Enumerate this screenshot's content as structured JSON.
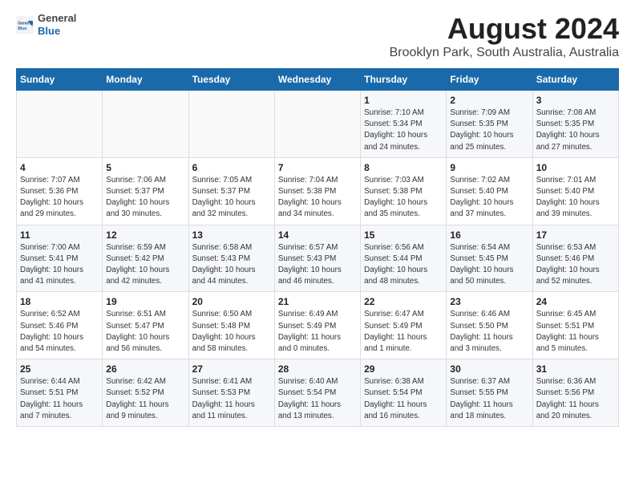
{
  "header": {
    "logo_general": "General",
    "logo_blue": "Blue",
    "title": "August 2024",
    "subtitle": "Brooklyn Park, South Australia, Australia"
  },
  "calendar": {
    "days_of_week": [
      "Sunday",
      "Monday",
      "Tuesday",
      "Wednesday",
      "Thursday",
      "Friday",
      "Saturday"
    ],
    "weeks": [
      [
        {
          "day": "",
          "info": ""
        },
        {
          "day": "",
          "info": ""
        },
        {
          "day": "",
          "info": ""
        },
        {
          "day": "",
          "info": ""
        },
        {
          "day": "1",
          "info": "Sunrise: 7:10 AM\nSunset: 5:34 PM\nDaylight: 10 hours\nand 24 minutes."
        },
        {
          "day": "2",
          "info": "Sunrise: 7:09 AM\nSunset: 5:35 PM\nDaylight: 10 hours\nand 25 minutes."
        },
        {
          "day": "3",
          "info": "Sunrise: 7:08 AM\nSunset: 5:35 PM\nDaylight: 10 hours\nand 27 minutes."
        }
      ],
      [
        {
          "day": "4",
          "info": "Sunrise: 7:07 AM\nSunset: 5:36 PM\nDaylight: 10 hours\nand 29 minutes."
        },
        {
          "day": "5",
          "info": "Sunrise: 7:06 AM\nSunset: 5:37 PM\nDaylight: 10 hours\nand 30 minutes."
        },
        {
          "day": "6",
          "info": "Sunrise: 7:05 AM\nSunset: 5:37 PM\nDaylight: 10 hours\nand 32 minutes."
        },
        {
          "day": "7",
          "info": "Sunrise: 7:04 AM\nSunset: 5:38 PM\nDaylight: 10 hours\nand 34 minutes."
        },
        {
          "day": "8",
          "info": "Sunrise: 7:03 AM\nSunset: 5:38 PM\nDaylight: 10 hours\nand 35 minutes."
        },
        {
          "day": "9",
          "info": "Sunrise: 7:02 AM\nSunset: 5:40 PM\nDaylight: 10 hours\nand 37 minutes."
        },
        {
          "day": "10",
          "info": "Sunrise: 7:01 AM\nSunset: 5:40 PM\nDaylight: 10 hours\nand 39 minutes."
        }
      ],
      [
        {
          "day": "11",
          "info": "Sunrise: 7:00 AM\nSunset: 5:41 PM\nDaylight: 10 hours\nand 41 minutes."
        },
        {
          "day": "12",
          "info": "Sunrise: 6:59 AM\nSunset: 5:42 PM\nDaylight: 10 hours\nand 42 minutes."
        },
        {
          "day": "13",
          "info": "Sunrise: 6:58 AM\nSunset: 5:43 PM\nDaylight: 10 hours\nand 44 minutes."
        },
        {
          "day": "14",
          "info": "Sunrise: 6:57 AM\nSunset: 5:43 PM\nDaylight: 10 hours\nand 46 minutes."
        },
        {
          "day": "15",
          "info": "Sunrise: 6:56 AM\nSunset: 5:44 PM\nDaylight: 10 hours\nand 48 minutes."
        },
        {
          "day": "16",
          "info": "Sunrise: 6:54 AM\nSunset: 5:45 PM\nDaylight: 10 hours\nand 50 minutes."
        },
        {
          "day": "17",
          "info": "Sunrise: 6:53 AM\nSunset: 5:46 PM\nDaylight: 10 hours\nand 52 minutes."
        }
      ],
      [
        {
          "day": "18",
          "info": "Sunrise: 6:52 AM\nSunset: 5:46 PM\nDaylight: 10 hours\nand 54 minutes."
        },
        {
          "day": "19",
          "info": "Sunrise: 6:51 AM\nSunset: 5:47 PM\nDaylight: 10 hours\nand 56 minutes."
        },
        {
          "day": "20",
          "info": "Sunrise: 6:50 AM\nSunset: 5:48 PM\nDaylight: 10 hours\nand 58 minutes."
        },
        {
          "day": "21",
          "info": "Sunrise: 6:49 AM\nSunset: 5:49 PM\nDaylight: 11 hours\nand 0 minutes."
        },
        {
          "day": "22",
          "info": "Sunrise: 6:47 AM\nSunset: 5:49 PM\nDaylight: 11 hours\nand 1 minute."
        },
        {
          "day": "23",
          "info": "Sunrise: 6:46 AM\nSunset: 5:50 PM\nDaylight: 11 hours\nand 3 minutes."
        },
        {
          "day": "24",
          "info": "Sunrise: 6:45 AM\nSunset: 5:51 PM\nDaylight: 11 hours\nand 5 minutes."
        }
      ],
      [
        {
          "day": "25",
          "info": "Sunrise: 6:44 AM\nSunset: 5:51 PM\nDaylight: 11 hours\nand 7 minutes."
        },
        {
          "day": "26",
          "info": "Sunrise: 6:42 AM\nSunset: 5:52 PM\nDaylight: 11 hours\nand 9 minutes."
        },
        {
          "day": "27",
          "info": "Sunrise: 6:41 AM\nSunset: 5:53 PM\nDaylight: 11 hours\nand 11 minutes."
        },
        {
          "day": "28",
          "info": "Sunrise: 6:40 AM\nSunset: 5:54 PM\nDaylight: 11 hours\nand 13 minutes."
        },
        {
          "day": "29",
          "info": "Sunrise: 6:38 AM\nSunset: 5:54 PM\nDaylight: 11 hours\nand 16 minutes."
        },
        {
          "day": "30",
          "info": "Sunrise: 6:37 AM\nSunset: 5:55 PM\nDaylight: 11 hours\nand 18 minutes."
        },
        {
          "day": "31",
          "info": "Sunrise: 6:36 AM\nSunset: 5:56 PM\nDaylight: 11 hours\nand 20 minutes."
        }
      ]
    ]
  }
}
